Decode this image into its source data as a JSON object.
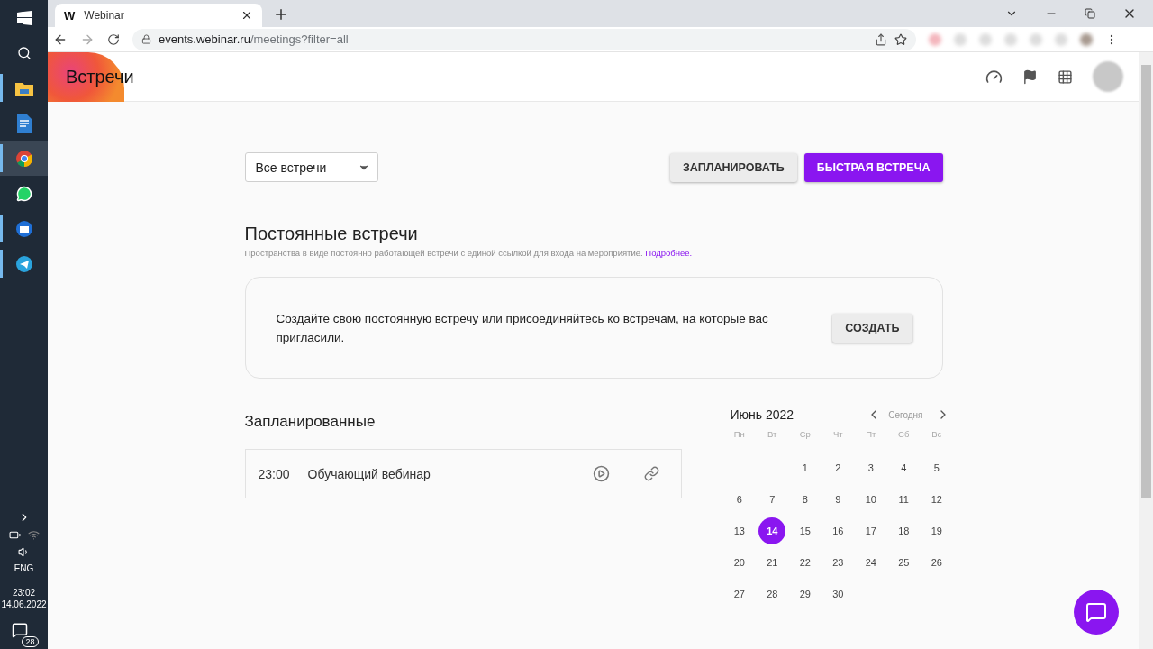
{
  "taskbar": {
    "apps": [
      {
        "kind": "windows",
        "running": false,
        "selected": false
      },
      {
        "kind": "search",
        "running": false,
        "selected": false
      },
      {
        "kind": "folder",
        "running": true,
        "selected": false
      },
      {
        "kind": "document",
        "running": false,
        "selected": false
      },
      {
        "kind": "browser",
        "running": true,
        "selected": true
      },
      {
        "kind": "chat",
        "running": false,
        "selected": false
      },
      {
        "kind": "mail",
        "running": true,
        "selected": false
      },
      {
        "kind": "messenger",
        "running": true,
        "selected": false
      }
    ],
    "language": "ENG",
    "time": "23:02",
    "date": "14.06.2022",
    "notifications": "28"
  },
  "browser": {
    "tab": {
      "favicon": "W",
      "title": "Webinar"
    },
    "url_host": "events.webinar.ru",
    "url_path": "/meetings?filter=all"
  },
  "header": {
    "title": "Встречи"
  },
  "filter": {
    "value": "Все встречи"
  },
  "actions": [
    {
      "label": "ЗАПЛАНИРОВАТЬ",
      "kind": "secondary"
    },
    {
      "label": "БЫСТРАЯ ВСТРЕЧА",
      "kind": "primary"
    }
  ],
  "permanent": {
    "heading": "Постоянные встречи",
    "description": "Пространства в виде постоянно работающей встречи с единой ссылкой для входа на мероприятие.",
    "link": "Подробнее.",
    "card_text": "Создайте свою постоянную встречу или присоединяйтесь ко встречам, на которые вас пригласили.",
    "card_button": "СОЗДАТЬ"
  },
  "scheduled": {
    "heading": "Запланированные",
    "meetings": [
      {
        "time": "23:00",
        "title": "Обучающий вебинар"
      }
    ]
  },
  "calendar": {
    "month": "Июнь 2022",
    "today": "Сегодня",
    "weekdays": [
      "Пн",
      "Вт",
      "Ср",
      "Чт",
      "Пт",
      "Сб",
      "Вс"
    ],
    "days": [
      {
        "kind": "blank"
      },
      {
        "kind": "blank"
      },
      {
        "kind": "day",
        "label": "1",
        "selected": false
      },
      {
        "kind": "day",
        "label": "2",
        "selected": false
      },
      {
        "kind": "day",
        "label": "3",
        "selected": false
      },
      {
        "kind": "day",
        "label": "4",
        "selected": false
      },
      {
        "kind": "day",
        "label": "5",
        "selected": false
      },
      {
        "kind": "day",
        "label": "6",
        "selected": false
      },
      {
        "kind": "day",
        "label": "7",
        "selected": false
      },
      {
        "kind": "day",
        "label": "8",
        "selected": false
      },
      {
        "kind": "day",
        "label": "9",
        "selected": false
      },
      {
        "kind": "day",
        "label": "10",
        "selected": false
      },
      {
        "kind": "day",
        "label": "11",
        "selected": false
      },
      {
        "kind": "day",
        "label": "12",
        "selected": false
      },
      {
        "kind": "day",
        "label": "13",
        "selected": false
      },
      {
        "kind": "day",
        "label": "14",
        "selected": true
      },
      {
        "kind": "day",
        "label": "15",
        "selected": false
      },
      {
        "kind": "day",
        "label": "16",
        "selected": false
      },
      {
        "kind": "day",
        "label": "17",
        "selected": false
      },
      {
        "kind": "day",
        "label": "18",
        "selected": false
      },
      {
        "kind": "day",
        "label": "19",
        "selected": false
      },
      {
        "kind": "day",
        "label": "20",
        "selected": false
      },
      {
        "kind": "day",
        "label": "21",
        "selected": false
      },
      {
        "kind": "day",
        "label": "22",
        "selected": false
      },
      {
        "kind": "day",
        "label": "23",
        "selected": false
      },
      {
        "kind": "day",
        "label": "24",
        "selected": false
      },
      {
        "kind": "day",
        "label": "25",
        "selected": false
      },
      {
        "kind": "day",
        "label": "26",
        "selected": false
      },
      {
        "kind": "day",
        "label": "27",
        "selected": false
      },
      {
        "kind": "day",
        "label": "28",
        "selected": false
      },
      {
        "kind": "day",
        "label": "29",
        "selected": false
      },
      {
        "kind": "day",
        "label": "30",
        "selected": false
      }
    ]
  }
}
